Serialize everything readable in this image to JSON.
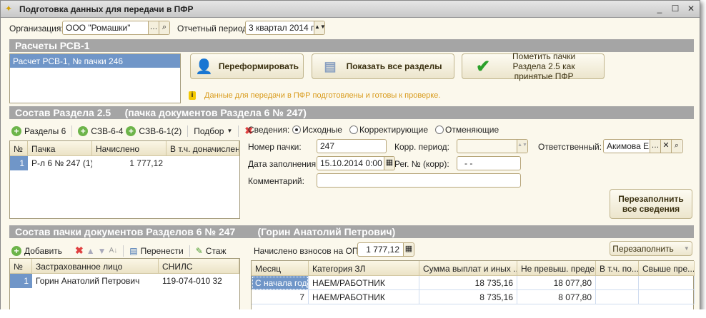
{
  "window": {
    "title": "Подготовка данных для передачи в ПФР"
  },
  "filters": {
    "org_label": "Организация:",
    "org_value": "ООО \"Ромашки\"",
    "period_label": "Отчетный период:",
    "period_value": "3 квартал 2014 г."
  },
  "rsv": {
    "header": "Расчеты РСВ-1",
    "items": [
      "Расчет РСВ-1, № пачки 246"
    ],
    "reform_button": "Переформировать",
    "show_button": "Показать все разделы",
    "mark_button": "Пометить пачки Раздела 2.5 как принятые ПФР",
    "info": "Данные для передачи в ПФР подготовлены и готовы к проверке."
  },
  "section": {
    "header": "Состав Раздела 2.5     (пачка документов Раздела 6 № 247)",
    "toolbar": {
      "razdely": "Разделы 6",
      "szv64": "СЗВ-6-4",
      "szv61": "СЗВ-6-1(2)",
      "podbor": "Подбор"
    },
    "columns": [
      "№",
      "Пачка",
      "Начислено",
      "В т.ч. доначислено"
    ],
    "rows": [
      {
        "n": "1",
        "pachka": "Р-л 6 № 247 (1)",
        "nachisleno": "1 777,12",
        "donach": ""
      }
    ],
    "form": {
      "svedeniya_label": "Сведения:",
      "radio": [
        "Исходные",
        "Корректирующие",
        "Отменяющие"
      ],
      "selected": "Исходные",
      "nomer_label": "Номер пачки:",
      "nomer_value": "247",
      "korr_label": "Корр. период:",
      "korr_value": "",
      "otv_label": "Ответственный:",
      "otv_value": "Акимова Е.",
      "date_label": "Дата заполнения:",
      "date_value": "15.10.2014 0:00",
      "reg_label": "Рег. № (корр):",
      "reg_value": "-  -",
      "comment_label": "Комментарий:",
      "comment_value": "",
      "refill_button": "Перезаполнить все сведения"
    }
  },
  "pack": {
    "header": "Состав пачки документов Разделов 6 № 247        (Горин Анатолий Петрович)",
    "toolbar": {
      "add": "Добавить",
      "move": "Перенести",
      "stazh": "Стаж"
    },
    "columns": [
      "№",
      "Застрахованное лицо",
      "СНИЛС"
    ],
    "rows": [
      {
        "n": "1",
        "name": "Горин Анатолий Петрович",
        "snils": "119-074-010 32"
      }
    ],
    "ops_label": "Начислено взносов на ОПС:",
    "ops_value": "1 777,12",
    "refill_button": "Перезаполнить",
    "detail_columns": [
      "Месяц",
      "Категория ЗЛ",
      "Сумма выплат и иных ...",
      "Не превыш. преде...",
      "В т.ч. по...",
      "Свыше пре..."
    ],
    "detail_rows": [
      [
        "С начала года",
        "НАЕМ/РАБОТНИК",
        "18 735,16",
        "18 077,80",
        "",
        ""
      ],
      [
        "7",
        "НАЕМ/РАБОТНИК",
        "8 735,16",
        "8 077,80",
        "",
        ""
      ]
    ]
  }
}
